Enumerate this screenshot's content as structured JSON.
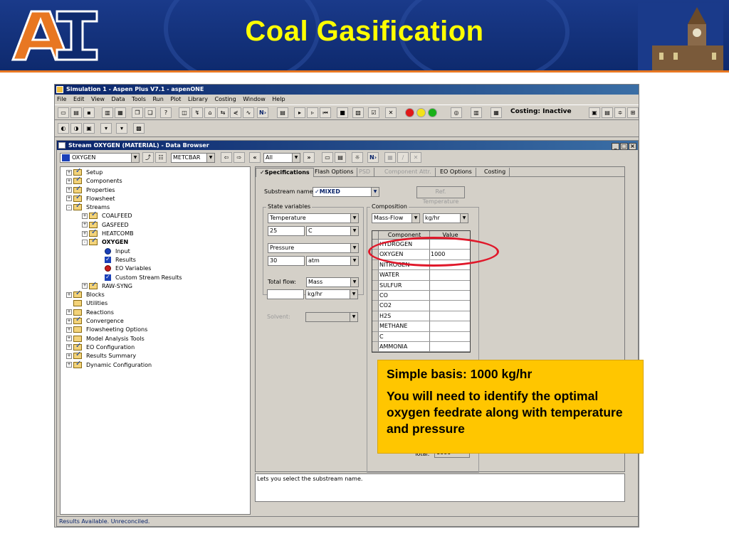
{
  "slide": {
    "title": "Coal Gasification"
  },
  "window": {
    "title": "Simulation 1 - Aspen Plus V7.1 - aspenONE",
    "menu": [
      "File",
      "Edit",
      "View",
      "Data",
      "Tools",
      "Run",
      "Plot",
      "Library",
      "Costing",
      "Window",
      "Help"
    ],
    "costing_label": "Costing: Inactive"
  },
  "browser": {
    "title": "Stream OXYGEN (MATERIAL) - Data Browser",
    "stream_select": "OXYGEN",
    "units_select": "METCBAR",
    "filter_select": "All",
    "tree": [
      {
        "label": "Setup",
        "icon": "check",
        "exp": "+",
        "indent": 0
      },
      {
        "label": "Components",
        "icon": "check",
        "exp": "+",
        "indent": 0
      },
      {
        "label": "Properties",
        "icon": "check",
        "exp": "+",
        "indent": 0
      },
      {
        "label": "Flowsheet",
        "icon": "check",
        "exp": "+",
        "indent": 0
      },
      {
        "label": "Streams",
        "icon": "check",
        "exp": "-",
        "indent": 0
      },
      {
        "label": "COALFEED",
        "icon": "check",
        "exp": "+",
        "indent": 1
      },
      {
        "label": "GASFEED",
        "icon": "check",
        "exp": "+",
        "indent": 1
      },
      {
        "label": "HEATCOMB",
        "icon": "check",
        "exp": "+",
        "indent": 1
      },
      {
        "label": "OXYGEN",
        "icon": "check",
        "exp": "-",
        "indent": 1,
        "bold": true
      },
      {
        "label": "Input",
        "icon": "blue",
        "exp": "",
        "indent": 2
      },
      {
        "label": "Results",
        "icon": "bluecheck",
        "exp": "",
        "indent": 2
      },
      {
        "label": "EO Variables",
        "icon": "red",
        "exp": "",
        "indent": 2
      },
      {
        "label": "Custom Stream Results",
        "icon": "bluecheck",
        "exp": "",
        "indent": 2
      },
      {
        "label": "RAW-SYNG",
        "icon": "check",
        "exp": "+",
        "indent": 1
      },
      {
        "label": "Blocks",
        "icon": "check",
        "exp": "+",
        "indent": 0
      },
      {
        "label": "Utilities",
        "icon": "folder",
        "exp": "",
        "indent": 0
      },
      {
        "label": "Reactions",
        "icon": "folder",
        "exp": "+",
        "indent": 0
      },
      {
        "label": "Convergence",
        "icon": "check",
        "exp": "+",
        "indent": 0
      },
      {
        "label": "Flowsheeting Options",
        "icon": "folder",
        "exp": "+",
        "indent": 0
      },
      {
        "label": "Model Analysis Tools",
        "icon": "folder",
        "exp": "+",
        "indent": 0
      },
      {
        "label": "EO Configuration",
        "icon": "check",
        "exp": "+",
        "indent": 0
      },
      {
        "label": "Results Summary",
        "icon": "check",
        "exp": "+",
        "indent": 0
      },
      {
        "label": "Dynamic Configuration",
        "icon": "check",
        "exp": "+",
        "indent": 0
      }
    ],
    "status": "Results Available. Unreconciled."
  },
  "form": {
    "tabs": [
      "✓Specifications",
      "Flash Options",
      "PSD",
      "Component Attr.",
      "EO Options",
      "Costing"
    ],
    "substream_label": "Substream name:",
    "substream_value": "✓MIXED",
    "ref_temp_button": "Ref. Temperature",
    "state_vars_label": "State variables",
    "temp_var": "Temperature",
    "temp_value": "25",
    "temp_unit": "C",
    "pressure_var": "Pressure",
    "pressure_value": "30",
    "pressure_unit": "atm",
    "total_flow_label": "Total flow:",
    "total_flow_basis": "Mass",
    "total_flow_value": "",
    "total_flow_unit": "kg/hr",
    "solvent_label": "Solvent:",
    "composition_label": "Composition",
    "comp_basis": "Mass-Flow",
    "comp_unit": "kg/hr",
    "grid_headers": [
      "Component",
      "Value"
    ],
    "components": [
      {
        "name": "HYDROGEN",
        "value": ""
      },
      {
        "name": "OXYGEN",
        "value": "1000"
      },
      {
        "name": "NITROGEN",
        "value": ""
      },
      {
        "name": "WATER",
        "value": ""
      },
      {
        "name": "SULFUR",
        "value": ""
      },
      {
        "name": "CO",
        "value": ""
      },
      {
        "name": "CO2",
        "value": ""
      },
      {
        "name": "H2S",
        "value": ""
      },
      {
        "name": "METHANE",
        "value": ""
      },
      {
        "name": "C",
        "value": ""
      },
      {
        "name": "AMMONIA",
        "value": ""
      }
    ],
    "total_label": "Total:",
    "total_value": "1000",
    "help_message": "Lets you select the substream name."
  },
  "callout": {
    "line1": "Simple basis: 1000 kg/hr",
    "line2": "You will need to identify the optimal oxygen feedrate along with temperature and pressure"
  },
  "colors": {
    "banner": "#1a3a8a",
    "title": "#ffff00",
    "callout": "#ffc600",
    "highlight": "#e0182a"
  }
}
